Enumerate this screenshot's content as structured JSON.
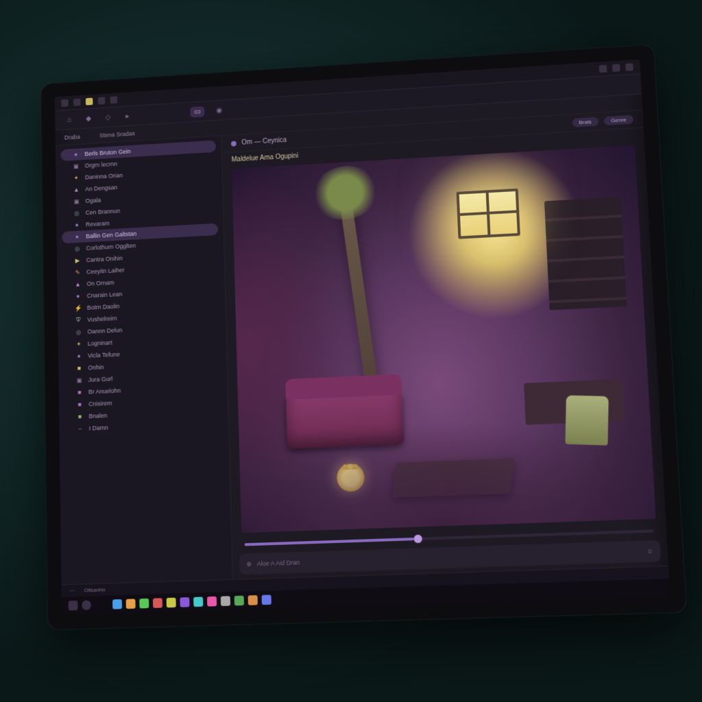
{
  "header": {
    "tab1": "Draba",
    "tab2": "Stena Sradas"
  },
  "sidebar": {
    "items": [
      {
        "label": "Berls Bruton Gein",
        "icon": "dot",
        "active": true
      },
      {
        "label": "Orgrn lecrnn",
        "icon": "box"
      },
      {
        "label": "Daninna Orian",
        "icon": "spark"
      },
      {
        "label": "An Dengsan",
        "icon": "tri"
      },
      {
        "label": "Ogala",
        "icon": "box"
      },
      {
        "label": "Cen Brannun",
        "icon": "ring"
      },
      {
        "label": "Revaram",
        "icon": "dot"
      },
      {
        "label": "Ballin Gen Galtstan",
        "icon": "dot",
        "active": true
      },
      {
        "label": "Corlothurn Ogglten",
        "icon": "ring"
      },
      {
        "label": "Cantra Onihin",
        "icon": "play"
      },
      {
        "label": "Ceeyitn Laiher",
        "icon": "pen"
      },
      {
        "label": "On Ornam",
        "icon": "tri"
      },
      {
        "label": "Cnarain Lean",
        "icon": "dot"
      },
      {
        "label": "Botrn Daolin",
        "icon": "bolt"
      },
      {
        "label": "Vushelreirn",
        "icon": "shield"
      },
      {
        "label": "Oannn Delun",
        "icon": "ring"
      },
      {
        "label": "Logninart",
        "icon": "spark"
      },
      {
        "label": "Vicla Tefune",
        "icon": "dot"
      },
      {
        "label": "Onhin",
        "icon": "sq-y"
      },
      {
        "label": "Jura Gurl",
        "icon": "box"
      },
      {
        "label": "Br Anuelohn",
        "icon": "sq-p"
      },
      {
        "label": "Cnisirem",
        "icon": "sq-p"
      },
      {
        "label": "Bnalen",
        "icon": "sq-g"
      },
      {
        "label": "I Damn",
        "icon": "dash"
      }
    ]
  },
  "viewer": {
    "breadcrumb": "Om — Ceynica",
    "title": "Maldelue Ama Ogupini",
    "action1": "Brals",
    "action2": "Genre"
  },
  "input": {
    "placeholder": "Aloe   A Aid   Dran"
  },
  "status": {
    "item1": "Olisanhn"
  },
  "icon_colors": {
    "dot": "#9a7ac8",
    "box": "#8a7098",
    "spark": "#c8a858",
    "tri": "#b58ad0",
    "ring": "#7a9a88",
    "play": "#c8c868",
    "pen": "#d0a060",
    "bolt": "#c878a0",
    "shield": "#8ab0b8",
    "sq-y": "#d4c468",
    "sq-p": "#a878c8",
    "sq-g": "#9ab868",
    "dash": "#888"
  },
  "taskbar_colors": [
    "#4aa0e8",
    "#e8a048",
    "#58c858",
    "#d85858",
    "#c8c848",
    "#8a58d8",
    "#48c8c8",
    "#e858a8",
    "#a8a8a8",
    "#58a858",
    "#d89048",
    "#6878e8"
  ]
}
